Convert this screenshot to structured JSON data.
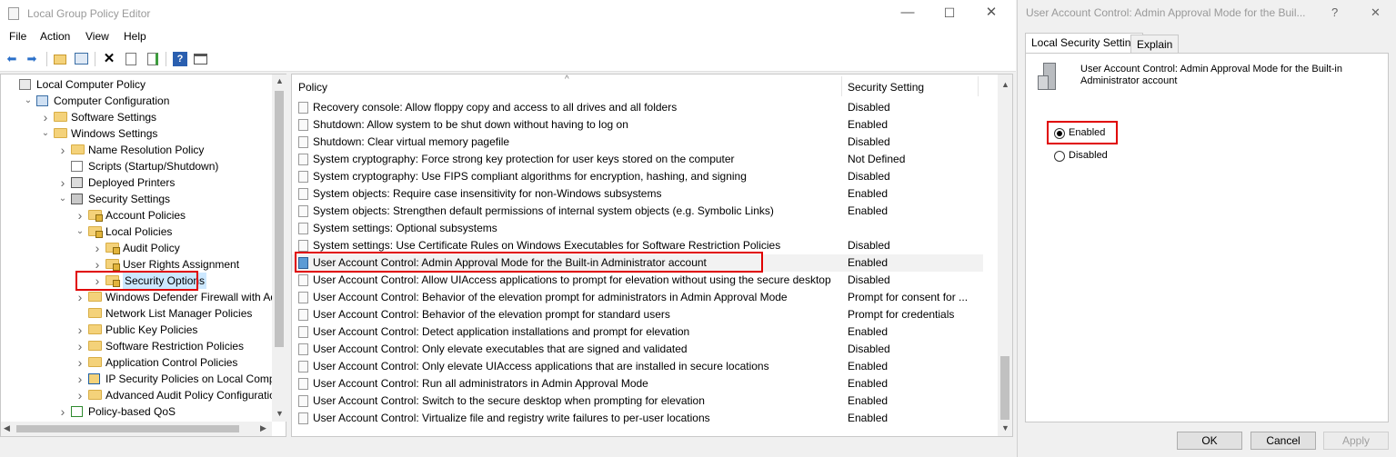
{
  "main_window": {
    "title": "Local Group Policy Editor",
    "window_buttons": {
      "minimize": "—",
      "maximize": "☐",
      "close": "✕"
    },
    "menu": [
      "File",
      "Action",
      "View",
      "Help"
    ],
    "toolbar_icons": [
      "back-icon",
      "forward-icon",
      "up-folder-icon",
      "show-hide-tree-icon",
      "delete-icon",
      "properties-icon",
      "export-icon",
      "help-icon",
      "filter-icon"
    ]
  },
  "tree": [
    {
      "label": "Local Computer Policy",
      "indent": 0,
      "expander": "",
      "icon": "computer-policy"
    },
    {
      "label": "Computer Configuration",
      "indent": 1,
      "expander": "v",
      "icon": "computer"
    },
    {
      "label": "Software Settings",
      "indent": 2,
      "expander": ">",
      "icon": "folder"
    },
    {
      "label": "Windows Settings",
      "indent": 2,
      "expander": "v",
      "icon": "folder"
    },
    {
      "label": "Name Resolution Policy",
      "indent": 3,
      "expander": ">",
      "icon": "folder"
    },
    {
      "label": "Scripts (Startup/Shutdown)",
      "indent": 3,
      "expander": "",
      "icon": "script"
    },
    {
      "label": "Deployed Printers",
      "indent": 3,
      "expander": ">",
      "icon": "printer"
    },
    {
      "label": "Security Settings",
      "indent": 3,
      "expander": "v",
      "icon": "security"
    },
    {
      "label": "Account Policies",
      "indent": 4,
      "expander": ">",
      "icon": "folder-lock"
    },
    {
      "label": "Local Policies",
      "indent": 4,
      "expander": "v",
      "icon": "folder-lock"
    },
    {
      "label": "Audit Policy",
      "indent": 5,
      "expander": ">",
      "icon": "folder-lock"
    },
    {
      "label": "User Rights Assignment",
      "indent": 5,
      "expander": ">",
      "icon": "folder-lock"
    },
    {
      "label": "Security Options",
      "indent": 5,
      "expander": ">",
      "icon": "folder-lock",
      "selected": true
    },
    {
      "label": "Windows Defender Firewall with Adva",
      "indent": 4,
      "expander": ">",
      "icon": "folder"
    },
    {
      "label": "Network List Manager Policies",
      "indent": 4,
      "expander": "",
      "icon": "folder"
    },
    {
      "label": "Public Key Policies",
      "indent": 4,
      "expander": ">",
      "icon": "folder"
    },
    {
      "label": "Software Restriction Policies",
      "indent": 4,
      "expander": ">",
      "icon": "folder"
    },
    {
      "label": "Application Control Policies",
      "indent": 4,
      "expander": ">",
      "icon": "folder"
    },
    {
      "label": "IP Security Policies on Local Compute",
      "indent": 4,
      "expander": ">",
      "icon": "ipsec"
    },
    {
      "label": "Advanced Audit Policy Configuration",
      "indent": 4,
      "expander": ">",
      "icon": "folder"
    },
    {
      "label": "Policy-based QoS",
      "indent": 3,
      "expander": ">",
      "icon": "chart"
    }
  ],
  "list": {
    "col_policy": "Policy",
    "col_setting": "Security Setting",
    "rows": [
      {
        "policy": "Recovery console: Allow floppy copy and access to all drives and all folders",
        "setting": "Disabled"
      },
      {
        "policy": "Shutdown: Allow system to be shut down without having to log on",
        "setting": "Enabled"
      },
      {
        "policy": "Shutdown: Clear virtual memory pagefile",
        "setting": "Disabled"
      },
      {
        "policy": "System cryptography: Force strong key protection for user keys stored on the computer",
        "setting": "Not Defined"
      },
      {
        "policy": "System cryptography: Use FIPS compliant algorithms for encryption, hashing, and signing",
        "setting": "Disabled"
      },
      {
        "policy": "System objects: Require case insensitivity for non-Windows subsystems",
        "setting": "Enabled"
      },
      {
        "policy": "System objects: Strengthen default permissions of internal system objects (e.g. Symbolic Links)",
        "setting": "Enabled"
      },
      {
        "policy": "System settings: Optional subsystems",
        "setting": ""
      },
      {
        "policy": "System settings: Use Certificate Rules on Windows Executables for Software Restriction Policies",
        "setting": "Disabled"
      },
      {
        "policy": "User Account Control: Admin Approval Mode for the Built-in Administrator account",
        "setting": "Enabled",
        "selected": true
      },
      {
        "policy": "User Account Control: Allow UIAccess applications to prompt for elevation without using the secure desktop",
        "setting": "Disabled"
      },
      {
        "policy": "User Account Control: Behavior of the elevation prompt for administrators in Admin Approval Mode",
        "setting": "Prompt for consent for ..."
      },
      {
        "policy": "User Account Control: Behavior of the elevation prompt for standard users",
        "setting": "Prompt for credentials"
      },
      {
        "policy": "User Account Control: Detect application installations and prompt for elevation",
        "setting": "Enabled"
      },
      {
        "policy": "User Account Control: Only elevate executables that are signed and validated",
        "setting": "Disabled"
      },
      {
        "policy": "User Account Control: Only elevate UIAccess applications that are installed in secure locations",
        "setting": "Enabled"
      },
      {
        "policy": "User Account Control: Run all administrators in Admin Approval Mode",
        "setting": "Enabled"
      },
      {
        "policy": "User Account Control: Switch to the secure desktop when prompting for elevation",
        "setting": "Enabled"
      },
      {
        "policy": "User Account Control: Virtualize file and registry write failures to per-user locations",
        "setting": "Enabled"
      }
    ]
  },
  "dialog": {
    "title": "User Account Control: Admin Approval Mode for the Buil...",
    "help": "?",
    "close": "✕",
    "tabs": [
      "Local Security Setting",
      "Explain"
    ],
    "policy_line1": "User Account Control: Admin Approval Mode for the Built-in",
    "policy_line2": "Administrator account",
    "option_enabled": "Enabled",
    "option_disabled": "Disabled",
    "selected_option": "Enabled",
    "ok": "OK",
    "cancel": "Cancel",
    "apply": "Apply"
  },
  "colors": {
    "highlight_border": "#e00000",
    "accent": "#0078d7"
  }
}
